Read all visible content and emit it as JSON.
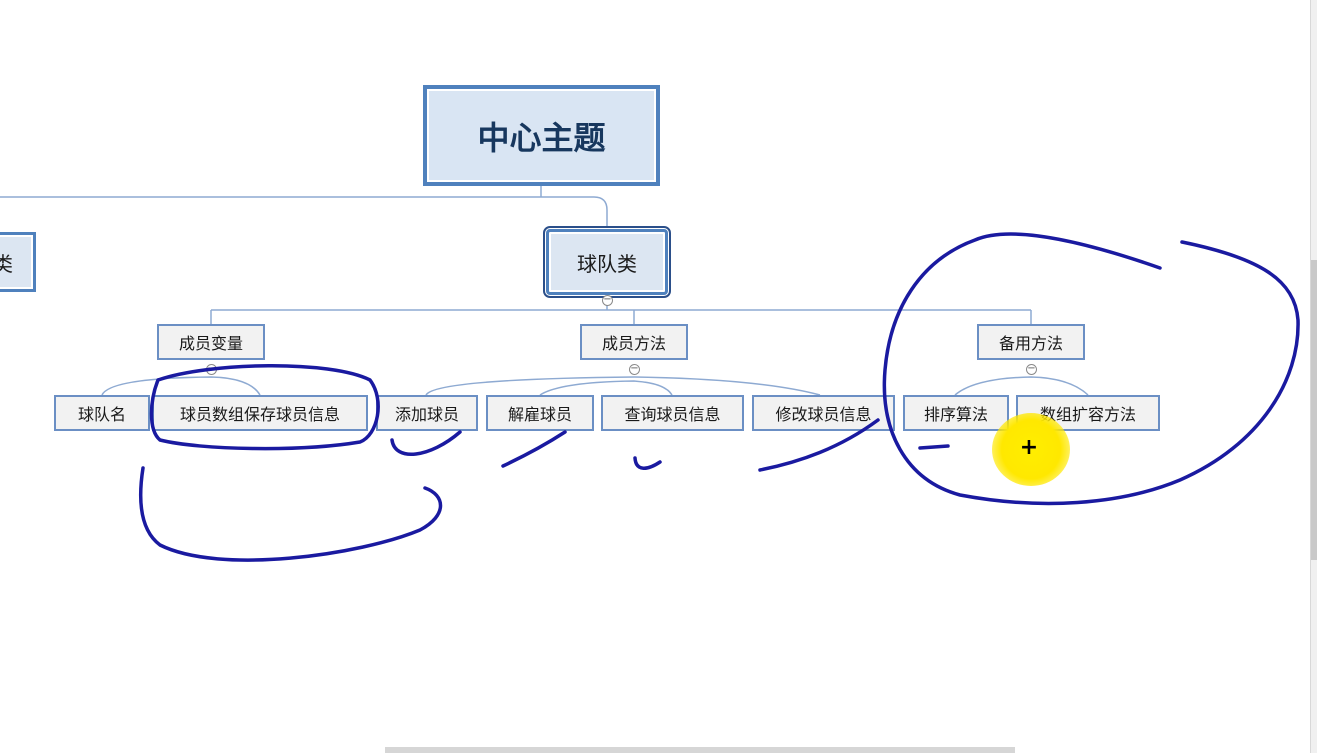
{
  "mindmap": {
    "root": "中心主题",
    "branch_left_partial": "类",
    "branch_main": "球队类",
    "subtopics": [
      {
        "label": "成员变量",
        "children": [
          "球队名",
          "球员数组保存球员信息"
        ]
      },
      {
        "label": "成员方法",
        "children": [
          "添加球员",
          "解雇球员",
          "查询球员信息",
          "修改球员信息"
        ]
      },
      {
        "label": "备用方法",
        "children": [
          "排序算法",
          "数组扩容方法"
        ]
      }
    ],
    "collapse_symbol": "−"
  },
  "annotation": {
    "ink_color": "#1a1aa0"
  },
  "cursor": {
    "symbol": "+",
    "highlight_color": "#ffe800"
  },
  "colors": {
    "accent": "#4f81bd",
    "connector": "#8eaad2"
  }
}
